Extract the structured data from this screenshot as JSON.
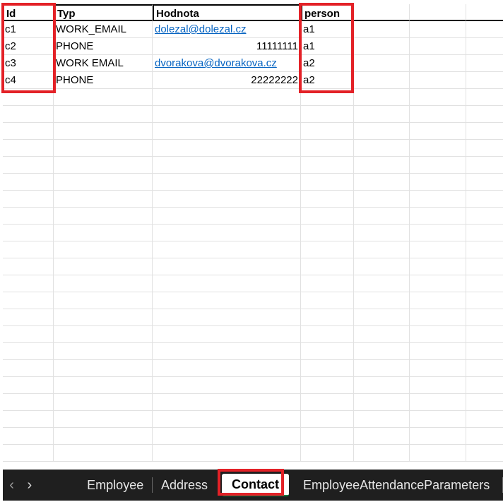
{
  "sheet": {
    "headers": [
      "Id",
      "Typ",
      "Hodnota",
      "person"
    ],
    "rows": [
      {
        "id": "c1",
        "typ": "WORK_EMAIL",
        "hodnota": "dolezal@dolezal.cz",
        "person": "a1"
      },
      {
        "id": "c2",
        "typ": "PHONE",
        "hodnota": "11111111",
        "person": "a1"
      },
      {
        "id": "c3",
        "typ": "WORK EMAIL",
        "hodnota": "dvorakova@dvorakova.cz",
        "person": "a2"
      },
      {
        "id": "c4",
        "typ": "PHONE",
        "hodnota": "22222222",
        "person": "a2"
      }
    ],
    "link_color": "#0563c1",
    "highlight_color": "#e32127"
  },
  "tabs": {
    "nav_prev": "‹",
    "nav_next": "›",
    "items": [
      "Employee",
      "Address",
      "Contact",
      "EmployeeAttendanceParameters"
    ],
    "active": "Contact"
  }
}
